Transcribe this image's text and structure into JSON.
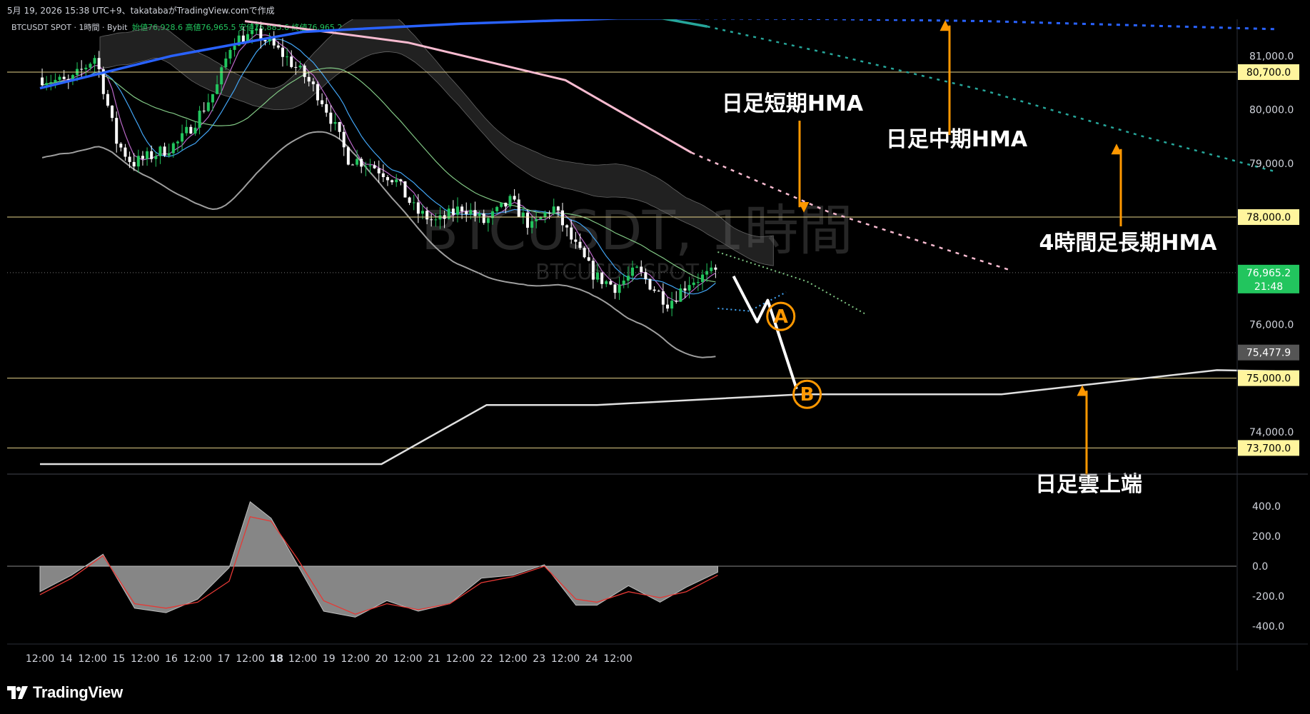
{
  "header": {
    "attribution": "5月 19, 2026 15:38 UTC+9、takatabaがTradingView.comで作成",
    "legend": "BTCUSDT SPOT · 1時間 · Bybit",
    "ohlc": "始値76,928.6 高値76,965.5 安値76,885.6 終値76,965.2"
  },
  "watermark": {
    "main": "BTCUSDT, 1時間",
    "sub": "BTCUSDT SPOT"
  },
  "footer": {
    "brand": "TradingView"
  },
  "colors": {
    "background": "#000000",
    "up_candle": "#22c55e",
    "down_candle": "#ffffff",
    "level_line": "#e6d38a",
    "annotation": "#ff9800",
    "hma_daily_short": "#f8bbd0",
    "hma_daily_mid": "#2962ff",
    "hma_4h_long": "#26a69a",
    "cloud": "#555555",
    "oscillator": "#888888",
    "signal": "#e53935"
  },
  "chart_data": {
    "type": "line",
    "symbol": "BTCUSDT SPOT",
    "timeframe": "1時間",
    "exchange": "Bybit",
    "x_tick_labels": [
      "12:00",
      "14",
      "12:00",
      "15",
      "12:00",
      "16",
      "12:00",
      "17",
      "12:00",
      "18",
      "12:00",
      "19",
      "12:00",
      "20",
      "12:00",
      "21",
      "12:00",
      "22",
      "12:00",
      "23",
      "12:00",
      "24",
      "12:00"
    ],
    "y_tick_labels": [
      "81,000.0",
      "80,000.0",
      "79,000.0",
      "76,000.0",
      "74,000.0"
    ],
    "ylim": [
      72800,
      82300
    ],
    "price_levels": [
      {
        "value": 80700,
        "label": "80,700.0"
      },
      {
        "value": 78000,
        "label": "78,000.0"
      },
      {
        "value": 75000,
        "label": "75,000.0"
      },
      {
        "value": 73700,
        "label": "73,700.0"
      }
    ],
    "current_price": {
      "value": 76965.2,
      "label": "76,965.2",
      "countdown": "21:48"
    },
    "marker_price": {
      "value": 75477.9,
      "label": "75,477.9"
    },
    "annotations": [
      {
        "text": "日足短期HMA",
        "points_to": 78050
      },
      {
        "text": "日足中期HMA",
        "points_to": 81700
      },
      {
        "text": "4時間足長期HMA",
        "points_to": 79400
      },
      {
        "text": "日足雲上端",
        "points_to": 74900
      }
    ],
    "scenario_path": {
      "points": [
        [
          13.2,
          76900
        ],
        [
          13.65,
          76050
        ],
        [
          13.85,
          76450
        ],
        [
          14.4,
          74800
        ]
      ],
      "labels": [
        "A",
        "B"
      ]
    },
    "daily_cloud_upper": {
      "name": "日足雲上端",
      "x": [
        0,
        6.5,
        8.5,
        10.6,
        14.5,
        18.3,
        22.4,
        23.5
      ],
      "y": [
        73400,
        73400,
        74500,
        74500,
        74700,
        74700,
        75150,
        75130
      ]
    },
    "hma_daily_short": {
      "name": "日足短期HMA",
      "x": [
        3.9,
        7,
        10,
        12.4,
        15,
        18.5
      ],
      "y": [
        81650,
        81250,
        80550,
        79200,
        78100,
        77000
      ]
    },
    "hma_daily_mid": {
      "name": "日足中期HMA",
      "x": [
        0,
        2.5,
        5,
        8,
        11,
        12.5,
        15,
        18,
        23.5
      ],
      "y": [
        80400,
        81000,
        81450,
        81600,
        81700,
        81700,
        81690,
        81650,
        81500
      ]
    },
    "hma_4h_long": {
      "name": "4時間足長期HMA",
      "x": [
        3,
        7,
        10.5,
        11.4,
        12.7,
        15,
        18,
        21,
        23.5
      ],
      "y": [
        81900,
        81850,
        81800,
        81780,
        81550,
        81050,
        80350,
        79500,
        78850
      ]
    },
    "oscillator": {
      "y_tick_labels": [
        "400.0",
        "200.0",
        "0.0",
        "-200.0",
        "-400.0"
      ],
      "ylim": [
        -430,
        460
      ],
      "x": [
        0,
        0.6,
        1.2,
        1.8,
        2.4,
        3.0,
        3.6,
        4.0,
        4.4,
        4.9,
        5.4,
        6.0,
        6.6,
        7.2,
        7.8,
        8.4,
        9.0,
        9.6,
        10.2,
        10.6,
        11.2,
        11.8,
        12.3,
        12.9
      ],
      "hist": [
        -170,
        -60,
        80,
        -280,
        -310,
        -220,
        -10,
        430,
        320,
        10,
        -300,
        -340,
        -230,
        -300,
        -250,
        -80,
        -60,
        10,
        -260,
        -260,
        -130,
        -240,
        -140,
        -40
      ],
      "signal": [
        -190,
        -80,
        70,
        -250,
        -280,
        -240,
        -100,
        330,
        300,
        50,
        -230,
        -320,
        -250,
        -290,
        -250,
        -110,
        -70,
        0,
        -220,
        -240,
        -170,
        -210,
        -170,
        -60
      ]
    }
  }
}
